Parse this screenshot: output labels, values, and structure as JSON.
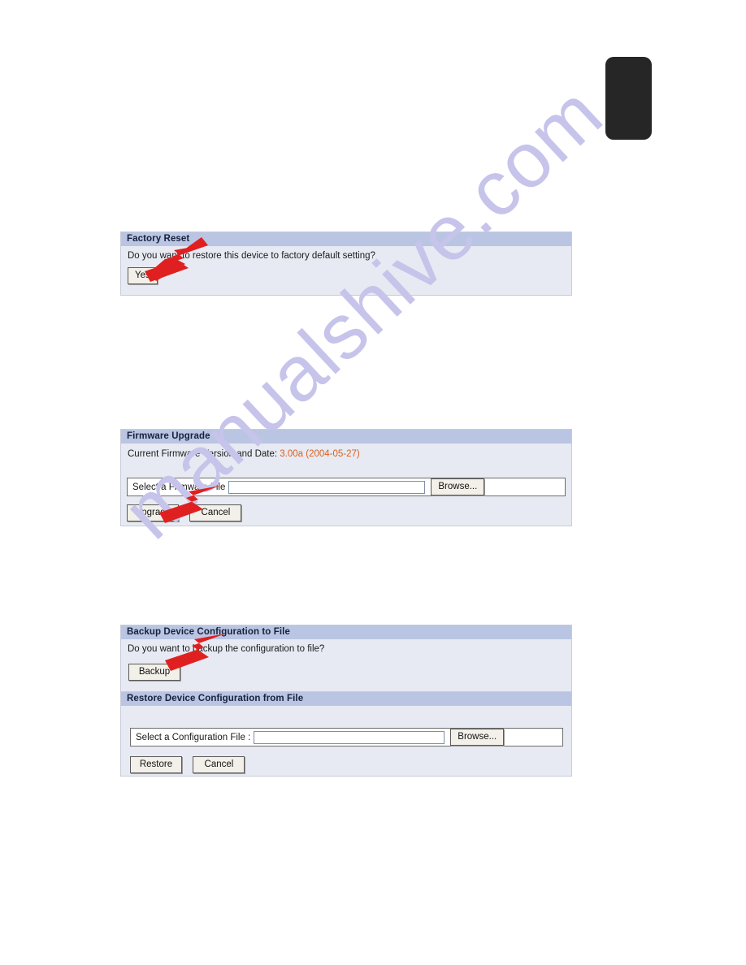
{
  "page": {
    "watermark": "manualshive.com",
    "tab_marker": "page-tab-marker"
  },
  "panels": [
    {
      "id": "factory-reset",
      "title": "Factory Reset",
      "prompt": "Do you want to restore this device to factory default setting?",
      "buttons": [
        {
          "id": "yes",
          "label": "Yes"
        }
      ]
    },
    {
      "id": "firmware-upgrade",
      "title": "Firmware Upgrade",
      "info_label": "Current Firmware Version and Date:",
      "info_value": "3.00a (2004-05-27)",
      "file_label": "Select a Firmware File",
      "file_value": "",
      "browse_label": "Browse...",
      "buttons": [
        {
          "id": "upgrade",
          "label": "Upgrade"
        },
        {
          "id": "cancel",
          "label": "Cancel"
        }
      ]
    },
    {
      "id": "backup-config",
      "title": "Backup Device Configuration to File",
      "prompt": "Do you want to backup the configuration to file?",
      "buttons": [
        {
          "id": "backup",
          "label": "Backup"
        }
      ]
    },
    {
      "id": "restore-config",
      "title": "Restore Device Configuration from File",
      "file_label": "Select a Configuration File :",
      "file_value": "",
      "browse_label": "Browse...",
      "buttons": [
        {
          "id": "restore",
          "label": "Restore"
        },
        {
          "id": "cancel",
          "label": "Cancel"
        }
      ]
    }
  ],
  "annotations": {
    "arrow_color": "#e02020",
    "arrows": [
      {
        "id": "arrow-to-yes",
        "target": "yes-button"
      },
      {
        "id": "arrow-to-upgrade",
        "target": "upgrade-button"
      },
      {
        "id": "arrow-to-backup",
        "target": "backup-button"
      }
    ]
  },
  "colors": {
    "panel_header": "#b9c5e2",
    "panel_body": "#e7eaf2",
    "accent_text": "#d9601f",
    "watermark": "#c6c4ea",
    "tab_marker": "#262626"
  }
}
